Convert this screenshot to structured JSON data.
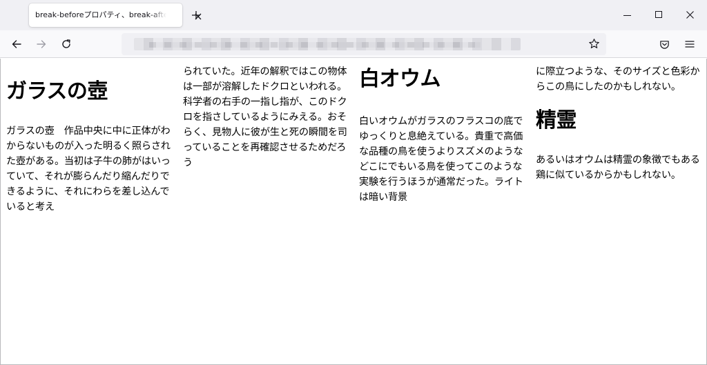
{
  "browser": {
    "tab": {
      "title": "break-beforeプロパティ、break-afterプロパティ"
    },
    "icons": {
      "tab_close": "close-icon",
      "new_tab": "plus-icon",
      "minimize": "minimize-icon",
      "maximize": "maximize-icon",
      "close": "close-icon",
      "back": "arrow-left-icon",
      "forward": "arrow-right-icon",
      "reload": "reload-icon",
      "bookmark": "star-icon",
      "pocket": "pocket-icon",
      "menu": "hamburger-icon"
    }
  },
  "page": {
    "col1": {
      "heading": "ガラスの壺",
      "body": "ガラスの壺　作品中央に中に正体がわからないものが入った明るく照らされた壺がある。当初は子牛の肺がはいっていて、それが膨らんだり縮んだりできるように、それにわらを差し込んでいると考え"
    },
    "col2": {
      "body": "られていた。近年の解釈ではこの物体は一部が溶解したドクロといわれる。科学者の右手の一指し指が、このドクロを指さしているようにみえる。おそらく、見物人に彼が生と死の瞬間を司っていることを再確認させるためだろう"
    },
    "col3": {
      "heading": "白オウム",
      "body": "白いオウムがガラスのフラスコの底でゆっくりと息絶えている。貴重で高価な品種の鳥を使うよりスズメのようなどこにでもいる鳥を使ってこのような実験を行うほうが通常だった。ライトは暗い背景"
    },
    "col4": {
      "lead": "に際立つような、そのサイズと色彩からこの鳥にしたのかもしれない。",
      "heading": "精霊",
      "body": "あるいはオウムは精霊の象徴でもある鶏に似ているからかもしれない。"
    }
  }
}
